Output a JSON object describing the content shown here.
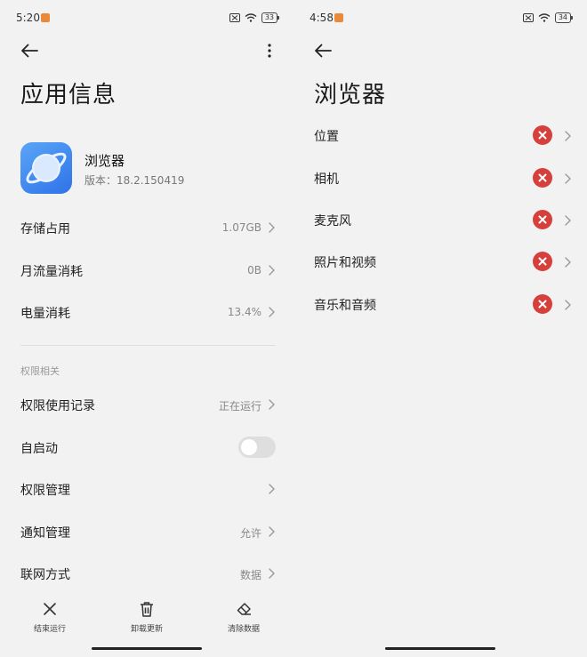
{
  "left": {
    "status": {
      "time": "5:20",
      "battery": "33"
    },
    "title": "应用信息",
    "app": {
      "name": "浏览器",
      "version": "版本：18.2.150419"
    },
    "rows": [
      {
        "label": "存储占用",
        "value": "1.07GB"
      },
      {
        "label": "月流量消耗",
        "value": "0B"
      },
      {
        "label": "电量消耗",
        "value": "13.4%"
      }
    ],
    "section_title": "权限相关",
    "perm_rows": {
      "record": {
        "label": "权限使用记录",
        "value": "正在运行"
      },
      "autostart": {
        "label": "自启动",
        "enabled": false
      },
      "manage": {
        "label": "权限管理",
        "value": ""
      },
      "notify": {
        "label": "通知管理",
        "value": "允许"
      },
      "network": {
        "label": "联网方式",
        "value": "数据"
      }
    },
    "bottom": {
      "stop": "结束运行",
      "uninstall": "卸载更新",
      "clear": "清除数据"
    }
  },
  "right": {
    "status": {
      "time": "4:58",
      "battery": "34"
    },
    "title": "浏览器",
    "permissions": [
      {
        "label": "位置",
        "state": "denied"
      },
      {
        "label": "相机",
        "state": "denied"
      },
      {
        "label": "麦克风",
        "state": "denied"
      },
      {
        "label": "照片和视频",
        "state": "denied"
      },
      {
        "label": "音乐和音频",
        "state": "denied"
      }
    ]
  },
  "colors": {
    "denied": "#d6403c",
    "background": "#f2f2f2",
    "app_icon": "#3d85ee"
  },
  "icons": {
    "back": "arrow-left-icon",
    "more": "more-vertical-icon",
    "chevron": "chevron-right-icon",
    "denied": "close-circle-icon",
    "stop": "close-icon",
    "uninstall": "trash-icon",
    "clear": "eraser-icon"
  }
}
